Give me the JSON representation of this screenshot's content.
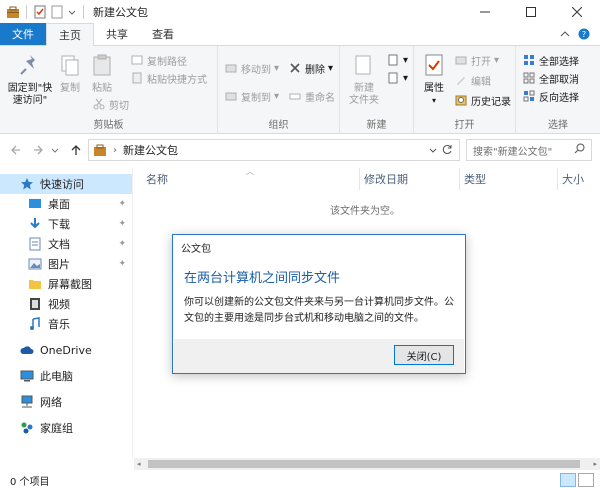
{
  "window": {
    "title": "新建公文包",
    "controls": [
      "minimize",
      "maximize",
      "close"
    ]
  },
  "ribbon_tabs": [
    {
      "label": "文件"
    },
    {
      "label": "主页"
    },
    {
      "label": "共享"
    },
    {
      "label": "查看"
    }
  ],
  "ribbon": {
    "clipboard": {
      "label": "剪贴板",
      "pin": "固定到\"快\n速访问\"",
      "copy": "复制",
      "paste": "粘贴",
      "copy_path": "复制路径",
      "paste_shortcut": "粘贴快捷方式",
      "cut": "剪切"
    },
    "organize": {
      "label": "组织",
      "move_to": "移动到",
      "copy_to": "复制到",
      "delete": "删除",
      "rename": "重命名"
    },
    "new": {
      "label": "新建",
      "new_folder": "新建\n文件夹"
    },
    "open": {
      "label": "打开",
      "properties": "属性",
      "open": "打开",
      "edit": "编辑",
      "history": "历史记录"
    },
    "select": {
      "label": "选择",
      "select_all": "全部选择",
      "select_none": "全部取消",
      "invert": "反向选择"
    }
  },
  "address": {
    "path": "新建公文包",
    "search_placeholder": "搜索\"新建公文包\""
  },
  "nav": {
    "quick_access": "快速访问",
    "items": [
      {
        "label": "桌面",
        "pinned": true
      },
      {
        "label": "下载",
        "pinned": true
      },
      {
        "label": "文档",
        "pinned": true
      },
      {
        "label": "图片",
        "pinned": true
      },
      {
        "label": "屏幕截图",
        "pinned": false
      },
      {
        "label": "视频",
        "pinned": false
      },
      {
        "label": "音乐",
        "pinned": false
      }
    ],
    "onedrive": "OneDrive",
    "this_pc": "此电脑",
    "network": "网络",
    "homegroup": "家庭组"
  },
  "columns": [
    "名称",
    "修改日期",
    "类型",
    "大小"
  ],
  "empty_message": "该文件夹为空。",
  "status": {
    "item_count": "0 个项目"
  },
  "dialog": {
    "title": "公文包",
    "heading": "在两台计算机之间同步文件",
    "body": "你可以创建新的公文包文件夹来与另一台计算机同步文件。公文包的主要用途是同步台式机和移动电脑之间的文件。",
    "close_button": "关闭(C)"
  },
  "colors": {
    "accent": "#1979ca",
    "dialog_border": "#2b79c4",
    "heading": "#1a5ea5",
    "selection": "#cce8ff"
  }
}
